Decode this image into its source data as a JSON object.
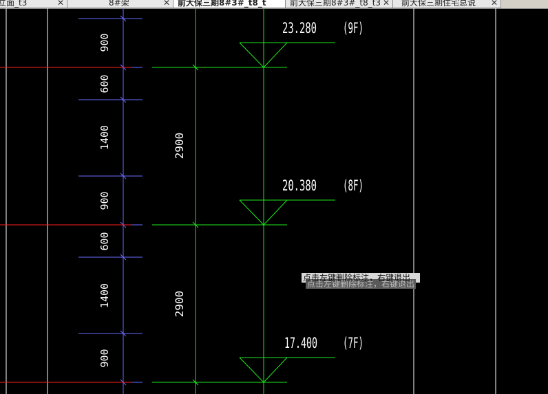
{
  "tabs": [
    {
      "label": "立面_t3",
      "active": false
    },
    {
      "label": "8#架",
      "active": false
    },
    {
      "label": "前大保三期8#3#_t8_t",
      "active": true
    },
    {
      "label": "前大保三期8#3#_t8_t3",
      "active": false
    },
    {
      "label": "前大保三期住宅总说",
      "active": false
    }
  ],
  "close_glyph": "✕",
  "drawing": {
    "segment_dims": [
      "900",
      "600",
      "1400",
      "900",
      "600",
      "1400",
      "900"
    ],
    "floor_dims": [
      "2900",
      "2900"
    ],
    "levels": [
      {
        "elevation": "23.280",
        "floor": "(9F)"
      },
      {
        "elevation": "20.380",
        "floor": "(8F)"
      },
      {
        "elevation": "17.400",
        "floor": "(7F)"
      }
    ],
    "colors": {
      "background": "#000000",
      "dimension_blue": "#6a6cff",
      "floor_line_red": "#ff1e1e",
      "green": "#1ee81e",
      "frame_white": "#ffffff"
    }
  },
  "tooltip": {
    "text": "点击左键删除标注，右键退出",
    "shadow_text": "点击左键删除标注，右键退出"
  }
}
